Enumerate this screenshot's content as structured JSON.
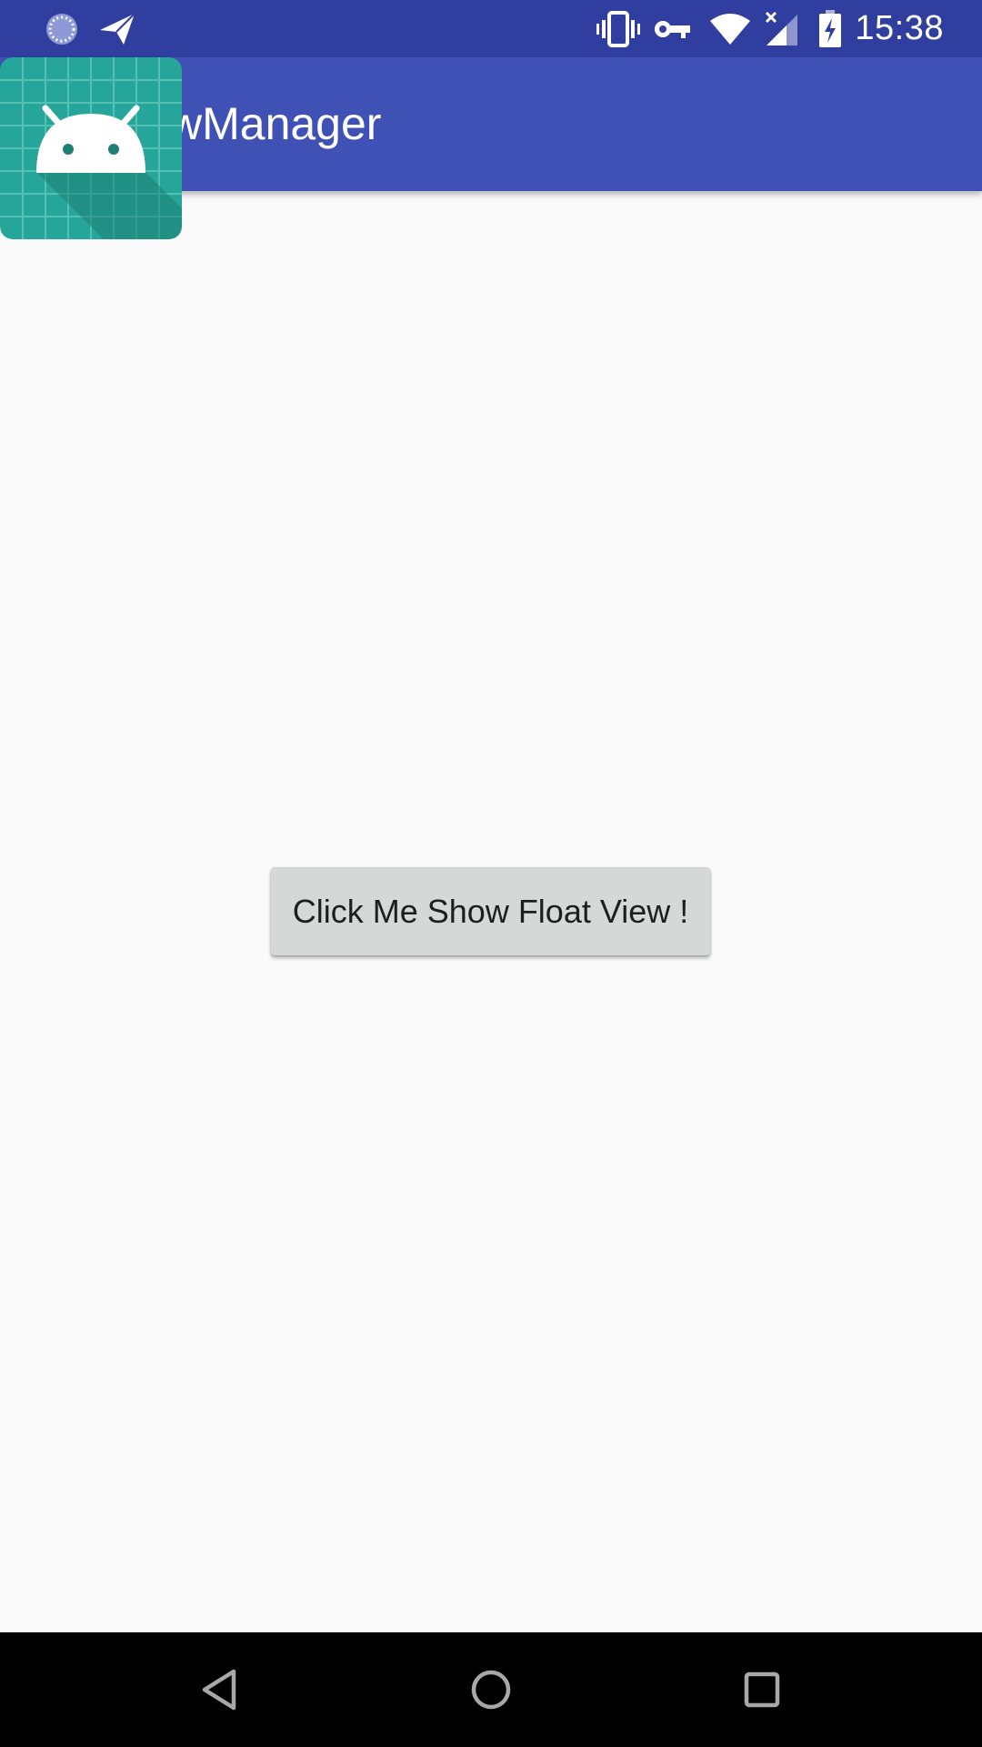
{
  "status_bar": {
    "time": "15:38",
    "icons": [
      "sync-icon",
      "send-icon",
      "vibrate-icon",
      "vpn-key-icon",
      "wifi-icon",
      "signal-icon",
      "battery-charging-icon"
    ]
  },
  "app_bar": {
    "title": "wManager"
  },
  "main": {
    "button_label": "Click Me Show Float View !"
  },
  "floating_icon": {
    "name": "android-app-icon"
  },
  "nav_bar": {
    "buttons": [
      "back-icon",
      "home-icon",
      "recents-icon"
    ]
  },
  "colors": {
    "status_bar": "#303f9f",
    "app_bar": "#3f51b5",
    "background": "#fafafa",
    "button": "#d6d7d7",
    "icon_teal": "#26a69a"
  }
}
